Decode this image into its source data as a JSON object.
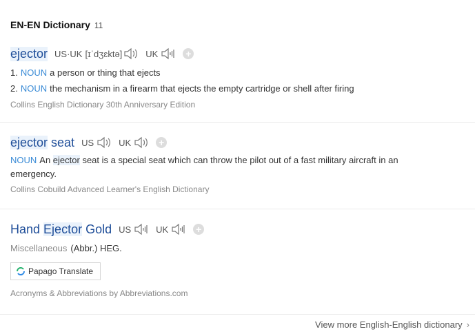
{
  "header": {
    "title": "EN-EN Dictionary",
    "count": "11"
  },
  "entries": [
    {
      "word": "ejector",
      "pron_us_uk_label": "US·UK",
      "ipa": "[ɪˈdʒɛktə]",
      "uk_label": "UK",
      "senses": [
        {
          "num": "1.",
          "pos": "NOUN",
          "text": "a person or thing that ejects"
        },
        {
          "num": "2.",
          "pos": "NOUN",
          "text": "the mechanism in a firearm that ejects the empty cartridge or shell after firing"
        }
      ],
      "source": "Collins English Dictionary 30th Anniversary Edition"
    },
    {
      "word_part1": "ejector",
      "word_part2": " seat",
      "us_label": "US",
      "uk_label": "UK",
      "sense": {
        "pos": "NOUN",
        "pre": "An ",
        "hl": "ejector",
        "post": " seat is a special seat which can throw the pilot out of a fast military aircraft in an",
        "line2": "emergency."
      },
      "source": "Collins Cobuild Advanced Learner's English Dictionary"
    },
    {
      "word_part1": "Hand ",
      "word_part2": "Ejector",
      "word_part3": " Gold",
      "us_label": "US",
      "uk_label": "UK",
      "category": "Miscellaneous",
      "definition": "(Abbr.) HEG.",
      "papago_label": "Papago Translate",
      "source": "Acronyms & Abbreviations by Abbreviations.com"
    }
  ],
  "footer": {
    "more_label": "View more English-English dictionary"
  },
  "icons": {
    "plus": "+",
    "chevron": "›"
  },
  "colors": {
    "word": "#1f4e99",
    "pos": "#3a8bd6",
    "highlight": "#eaf2fb"
  }
}
